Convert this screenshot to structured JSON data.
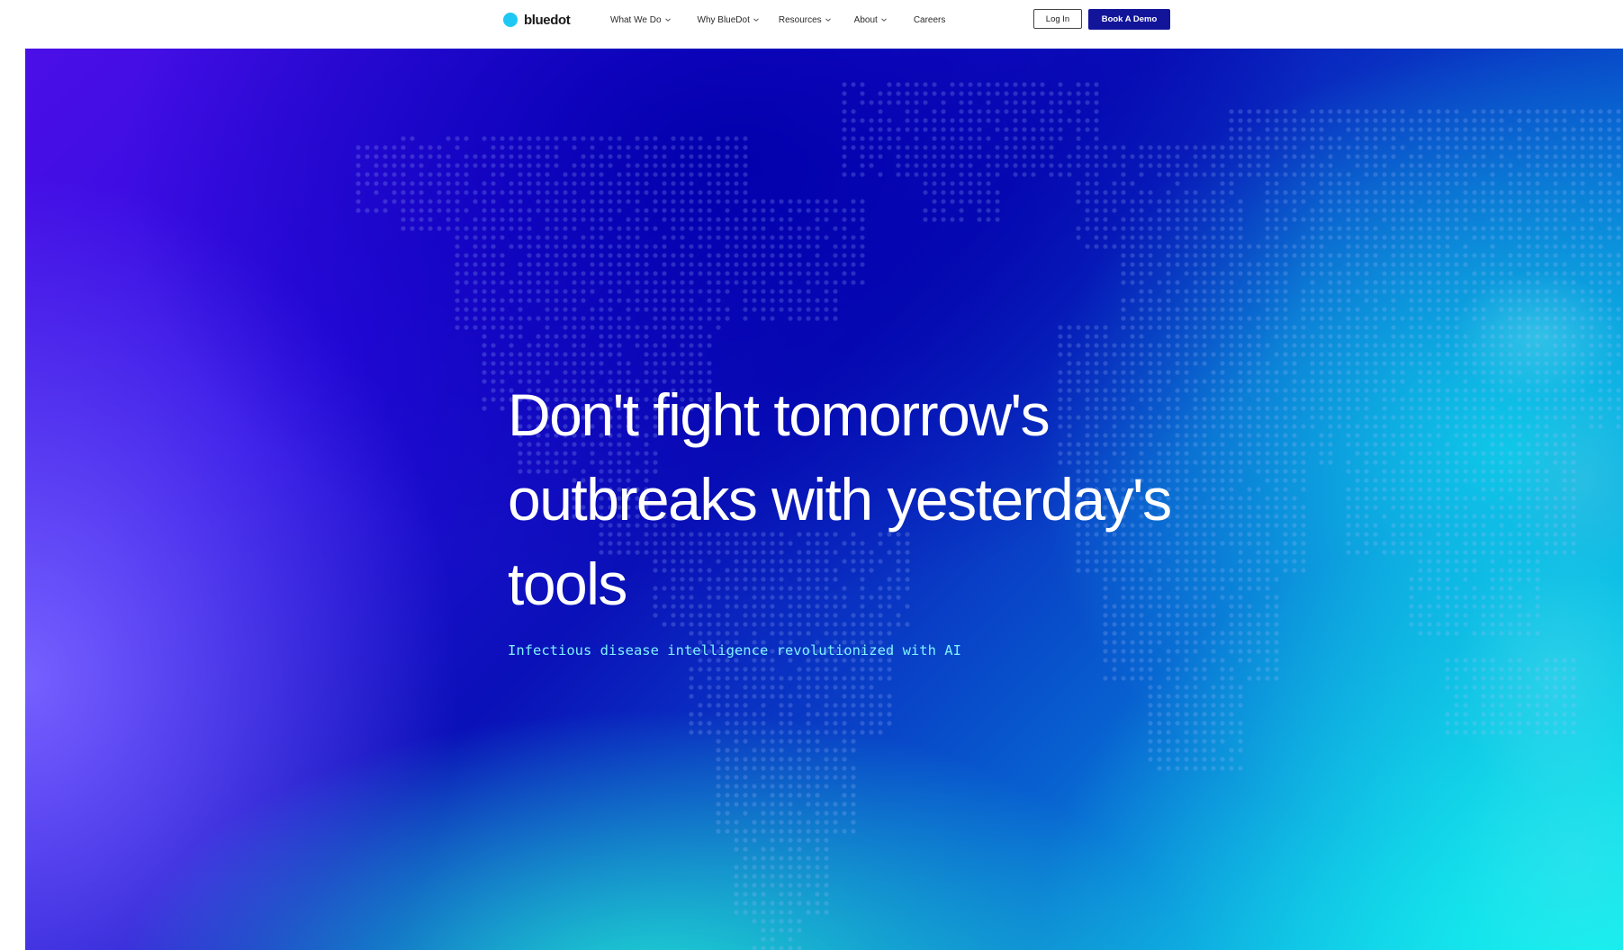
{
  "nav": {
    "logo_text": "bluedot",
    "items": [
      {
        "label": "What We Do",
        "has_dropdown": true
      },
      {
        "label": "Why BlueDot",
        "has_dropdown": true
      },
      {
        "label": "Resources",
        "has_dropdown": true
      },
      {
        "label": "About",
        "has_dropdown": true
      },
      {
        "label": "Careers",
        "has_dropdown": false
      }
    ],
    "login_label": "Log In",
    "demo_label": "Book A Demo"
  },
  "hero": {
    "headline": "Don't fight tomorrow's outbreaks with yesterday's tools",
    "tagline": "Infectious disease intelligence revolutionized with AI"
  },
  "colors": {
    "logo_dot": "#1ec8f5",
    "demo_button": "#12149a",
    "tagline": "#7ef2ff",
    "hero_purple": "#4b0fe6",
    "hero_navy": "#0a11b8",
    "hero_cyan": "#16f0ee"
  }
}
